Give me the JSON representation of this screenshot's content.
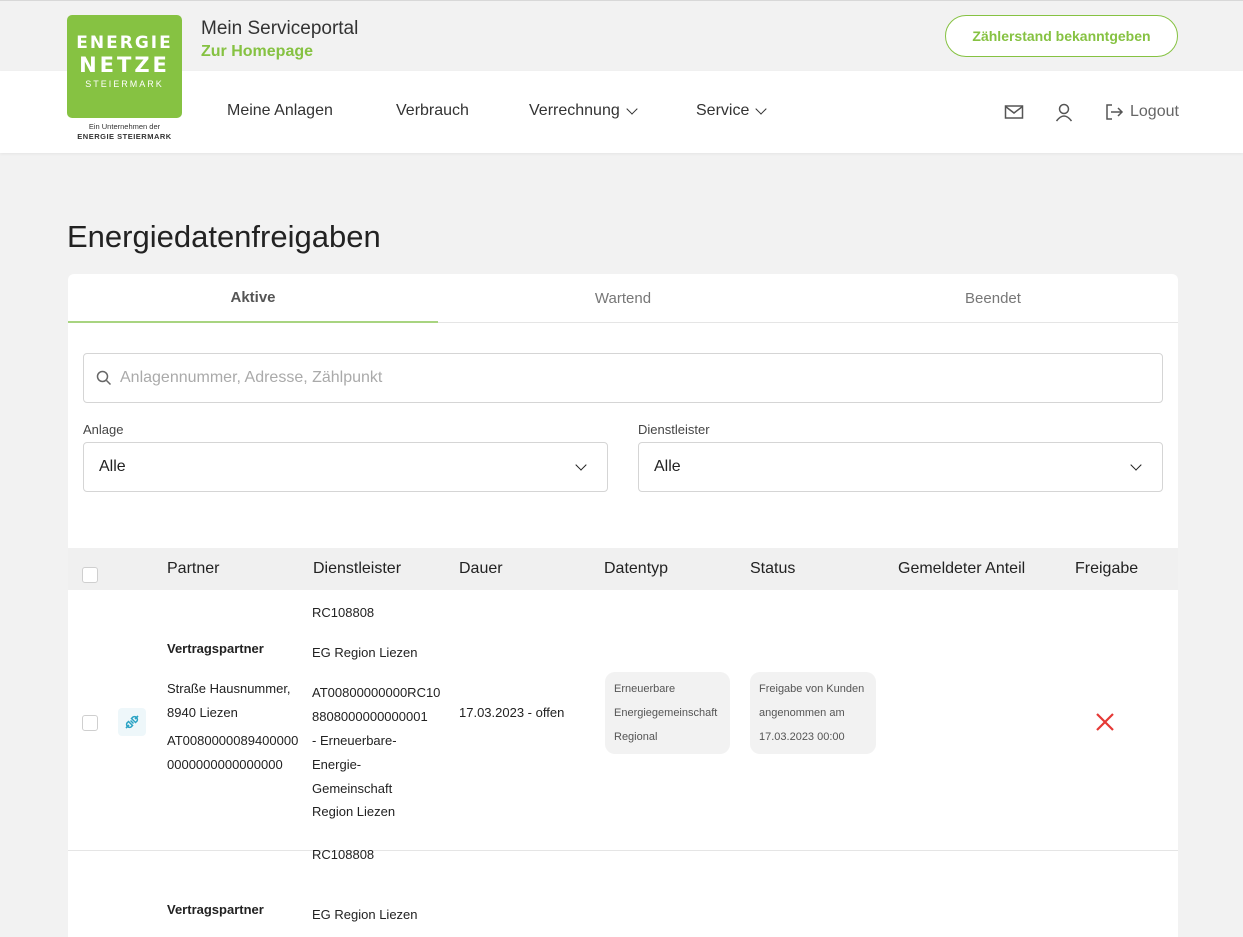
{
  "header": {
    "logo_line1": "ENERGIE",
    "logo_line2": "NETZE",
    "logo_line3": "STEIERMARK",
    "logo_sub1": "Ein Unternehmen der",
    "logo_sub2": "ENERGIE STEIERMARK",
    "portal_title": "Mein Serviceportal",
    "homepage_link": "Zur Homepage",
    "meter_button": "Zählerstand bekanntgeben"
  },
  "nav": {
    "items": [
      "Meine Anlagen",
      "Verbrauch",
      "Verrechnung",
      "Service"
    ],
    "logout": "Logout"
  },
  "page": {
    "title": "Energiedatenfreigaben"
  },
  "tabs": [
    "Aktive",
    "Wartend",
    "Beendet"
  ],
  "search": {
    "placeholder": "Anlagennummer, Adresse, Zählpunkt"
  },
  "filters": {
    "anlage_label": "Anlage",
    "anlage_value": "Alle",
    "dienstleister_label": "Dienstleister",
    "dienstleister_value": "Alle"
  },
  "table": {
    "headers": [
      "Partner",
      "Dienstleister",
      "Dauer",
      "Datentyp",
      "Status",
      "Gemeldeter Anteil",
      "Freigabe"
    ],
    "rows": [
      {
        "partner_title": "Vertragspartner",
        "partner_address1": "Straße Hausnummer,",
        "partner_address2": "8940 Liezen",
        "partner_meter1": "AT0080000089400000",
        "partner_meter2": "0000000000000000",
        "provider_id": "RC108808",
        "provider_name": "EG Region Liezen",
        "provider_detail": [
          "AT00800000000RC10",
          "8808000000000001",
          "- Erneuerbare-",
          "Energie-",
          "Gemeinschaft"
        ],
        "provider_region": "Region Liezen",
        "duration": "17.03.2023 - offen",
        "datatype": [
          "Erneuerbare",
          "Energiegemeinschaft",
          "Regional"
        ],
        "status": [
          "Freigabe von Kunden",
          "angenommen am",
          "17.03.2023 00:00"
        ]
      },
      {
        "partner_title": "Vertragspartner",
        "provider_id": "RC108808",
        "provider_name": "EG Region Liezen"
      }
    ]
  },
  "colors": {
    "brand_green": "#86c242",
    "revoke_red": "#e53935",
    "plug_blue": "#2aa3c4"
  }
}
